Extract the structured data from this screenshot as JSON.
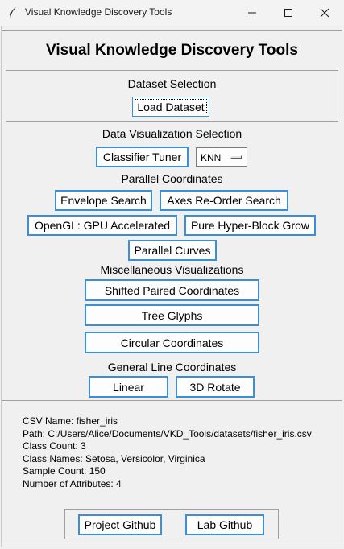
{
  "window": {
    "title": "Visual Knowledge Discovery Tools"
  },
  "heading": "Visual Knowledge Discovery Tools",
  "dataset": {
    "label": "Dataset Selection",
    "load_button": "Load Dataset"
  },
  "visualization": {
    "label": "Data Visualization Selection",
    "classifier_tuner": "Classifier Tuner",
    "classifier_select": "KNN"
  },
  "parallel": {
    "label": "Parallel Coordinates",
    "envelope_search": "Envelope Search",
    "axes_reorder": "Axes Re-Order Search",
    "opengl": "OpenGL: GPU Accelerated",
    "hyper_block": "Pure Hyper-Block Grow",
    "parallel_curves": "Parallel Curves"
  },
  "misc": {
    "label": "Miscellaneous Visualizations",
    "shifted_paired": "Shifted Paired Coordinates",
    "tree_glyphs": "Tree Glyphs",
    "circular": "Circular Coordinates"
  },
  "glc": {
    "label": "General Line Coordinates",
    "linear": "Linear",
    "rotate3d": "3D Rotate"
  },
  "info": {
    "csv_name": "CSV Name: fisher_iris",
    "path": "Path: C:/Users/Alice/Documents/VKD_Tools/datasets/fisher_iris.csv",
    "class_count": "Class Count: 3",
    "class_names": "Class Names: Setosa, Versicolor, Virginica",
    "sample_count": "Sample Count: 150",
    "attributes": "Number of Attributes: 4"
  },
  "footer": {
    "project_github": "Project Github",
    "lab_github": "Lab Github"
  }
}
